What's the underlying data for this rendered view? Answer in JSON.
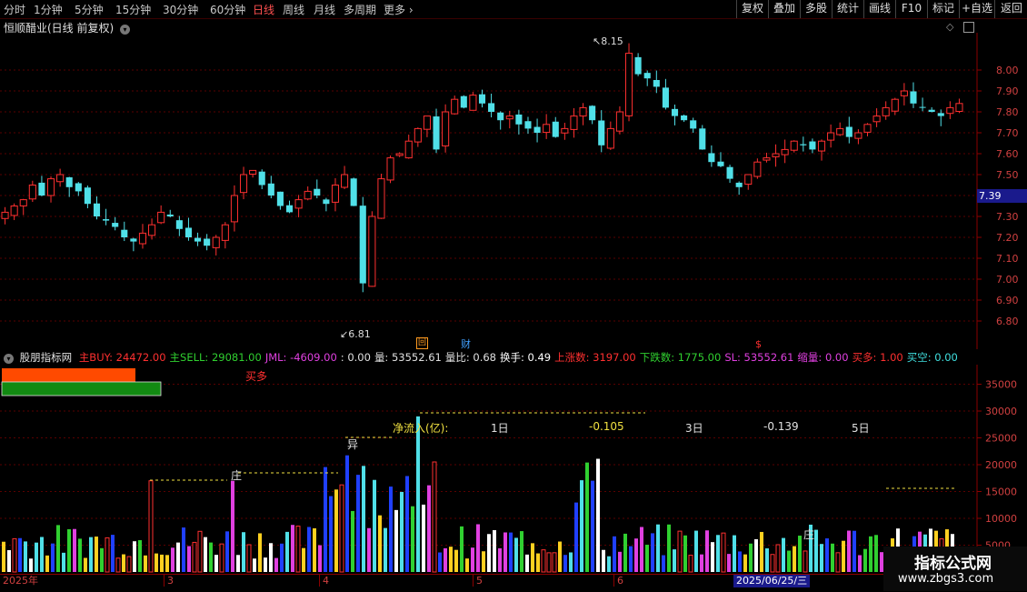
{
  "toolbar": {
    "timeframes": [
      "分时",
      "1分钟",
      "5分钟",
      "15分钟",
      "30分钟",
      "60分钟",
      "日线",
      "周线",
      "月线",
      "多周期",
      "更多"
    ],
    "active_timeframe": "日线",
    "buttons": [
      "复权",
      "叠加",
      "多股",
      "统计",
      "画线",
      "F10",
      "标记",
      "+自选",
      "返回"
    ]
  },
  "main_chart": {
    "title": "恒顺醋业(日线 前复权)",
    "high_label": "8.15",
    "low_label": "6.81",
    "current_price": "7.39",
    "y_ticks": [
      "8.00",
      "7.90",
      "7.80",
      "7.70",
      "7.60",
      "7.50",
      "7.40",
      "7.30",
      "7.20",
      "7.10",
      "7.00",
      "6.90",
      "6.80"
    ],
    "event_marks": [
      "回",
      "财",
      "$"
    ]
  },
  "indicator": {
    "name": "股朋指标网",
    "values": [
      {
        "label": "主BUY:",
        "value": "24472.00",
        "color": "#ff3030"
      },
      {
        "label": "主SELL:",
        "value": "29081.00",
        "color": "#30d030"
      },
      {
        "label": "JML:",
        "value": "-4609.00",
        "color": "#e040e0"
      },
      {
        "label": ":",
        "value": "0.00",
        "color": "#e0e0e0"
      },
      {
        "label": "量:",
        "value": "53552.61",
        "color": "#e0e0e0"
      },
      {
        "label": "量比:",
        "value": "0.68",
        "color": "#e0e0e0"
      },
      {
        "label": "换手:",
        "value": "0.49",
        "color": "#ffffff"
      },
      {
        "label": "上涨数:",
        "value": "3197.00",
        "color": "#ff3030"
      },
      {
        "label": "下跌数:",
        "value": "1775.00",
        "color": "#30d030"
      },
      {
        "label": "SL:",
        "value": "53552.61",
        "color": "#e040e0"
      },
      {
        "label": "缩量:",
        "value": "0.00",
        "color": "#e040e0"
      },
      {
        "label": "买多:",
        "value": "1.00",
        "color": "#ff3030"
      },
      {
        "label": "买空:",
        "value": "0.00",
        "color": "#40e0e0"
      }
    ],
    "buy_label": "买多",
    "flow_label": "净流入(亿):",
    "flow_periods": [
      "1日",
      "3日",
      "5日"
    ],
    "flow_values": [
      "-0.105",
      "-0.139"
    ],
    "markers": [
      "庄",
      "异",
      "庄"
    ],
    "y_ticks": [
      "35000",
      "30000",
      "25000",
      "20000",
      "15000",
      "10000",
      "5000"
    ]
  },
  "x_axis": {
    "labels": [
      "2025年",
      "3",
      "4",
      "5",
      "6"
    ],
    "cursor_date": "2025/06/25/三"
  },
  "watermark": {
    "line1": "指标公式网",
    "line2": "www.zbgs3.com"
  }
}
